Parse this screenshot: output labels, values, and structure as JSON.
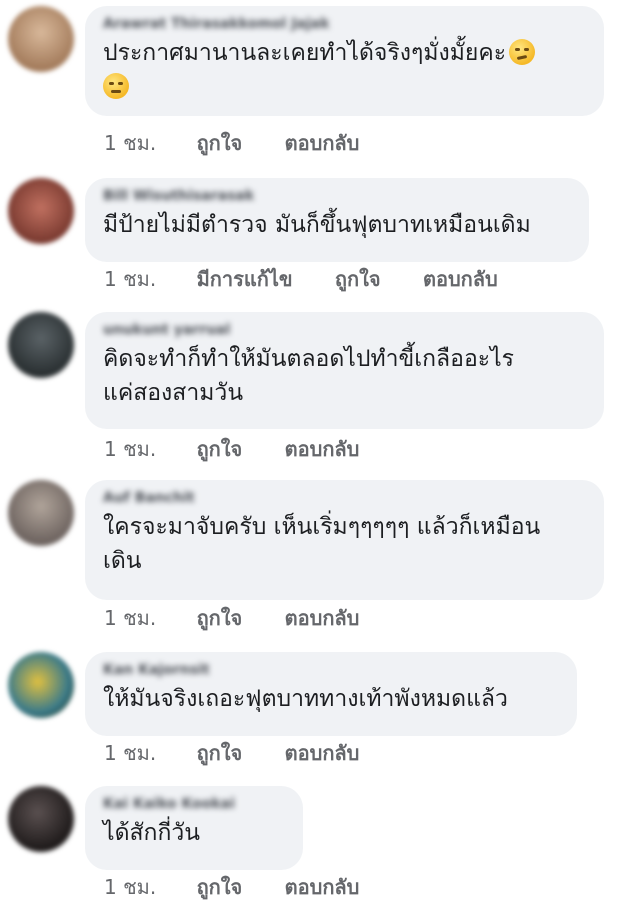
{
  "comments": [
    {
      "author": "Arawrat Thirasakkomol Jajak",
      "lines": [
        "ประกาศมานานละเคยทำได้จริงๆมั่งมั้ยคะ",
        ""
      ],
      "emojis": [
        "smirk-emoji",
        "rolling-eyes-emoji"
      ],
      "time": "1 ชม.",
      "like": "ถูกใจ",
      "reply": "ตอบกลับ",
      "avatar_color": "#b08a6a"
    },
    {
      "author": "Bill Wisuthisarasak",
      "lines": [
        "มีป้ายไม่มีตำรวจ มันก็ขึ้นฟุตบาทเหมือนเดิม"
      ],
      "time": "1 ชม.",
      "edited": "มีการแก้ไข",
      "like": "ถูกใจ",
      "reply": "ตอบกลับ",
      "avatar_color": "#8a4a3a"
    },
    {
      "author": "unukunt yarrual",
      "lines": [
        "คิดจะทำก็ทำให้มันตลอดไปทำขี้เกลืออะไร",
        "แค่สองสามวัน"
      ],
      "time": "1 ชม.",
      "like": "ถูกใจ",
      "reply": "ตอบกลับ",
      "avatar_color": "#3d4548"
    },
    {
      "author": "Auf Banchit",
      "lines": [
        "ใครจะมาจับครับ เห็นเริ่มๆๆๆๆๆ แล้วก็เหมือน",
        "เดิน"
      ],
      "time": "1 ชม.",
      "like": "ถูกใจ",
      "reply": "ตอบกลับ",
      "avatar_color": "#9a8a80"
    },
    {
      "author": "Kan Kajornsit",
      "lines": [
        "ให้มันจริงเถอะฟุตบาททางเท้าพังหมดแล้ว"
      ],
      "time": "1 ชม.",
      "like": "ถูกใจ",
      "reply": "ตอบกลับ",
      "avatar_color": "#6e8a3a"
    },
    {
      "author": "Kai Kaiko Kookai",
      "lines": [
        "ได้สักกี่วัน"
      ],
      "time": "1 ชม.",
      "like": "ถูกใจ",
      "reply": "ตอบกลับ",
      "avatar_color": "#2e2a2a"
    }
  ]
}
